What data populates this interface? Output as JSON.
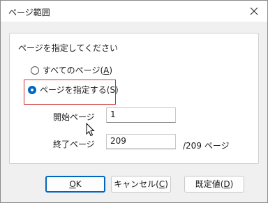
{
  "window": {
    "title": "ページ範囲"
  },
  "group": {
    "label": "ページを指定してください"
  },
  "options": {
    "all_label": "すべてのページ(",
    "all_accel": "A",
    "all_close": ")",
    "all_checked": false,
    "specify_label": "ページを指定する(S)",
    "specify_checked": true
  },
  "fields": {
    "start_label": "開始ページ",
    "start_value": "1",
    "end_label": "終了ページ",
    "end_value": "209",
    "total_text": "/209 ページ"
  },
  "buttons": {
    "ok_accel": "O",
    "ok_rest": "K",
    "cancel_prefix": "キャンセル(",
    "cancel_accel": "C",
    "cancel_suffix": ")",
    "default_prefix": "既定値(",
    "default_accel": "D",
    "default_suffix": ")"
  },
  "colors": {
    "accent": "#0067c0",
    "highlight": "#d03030"
  }
}
